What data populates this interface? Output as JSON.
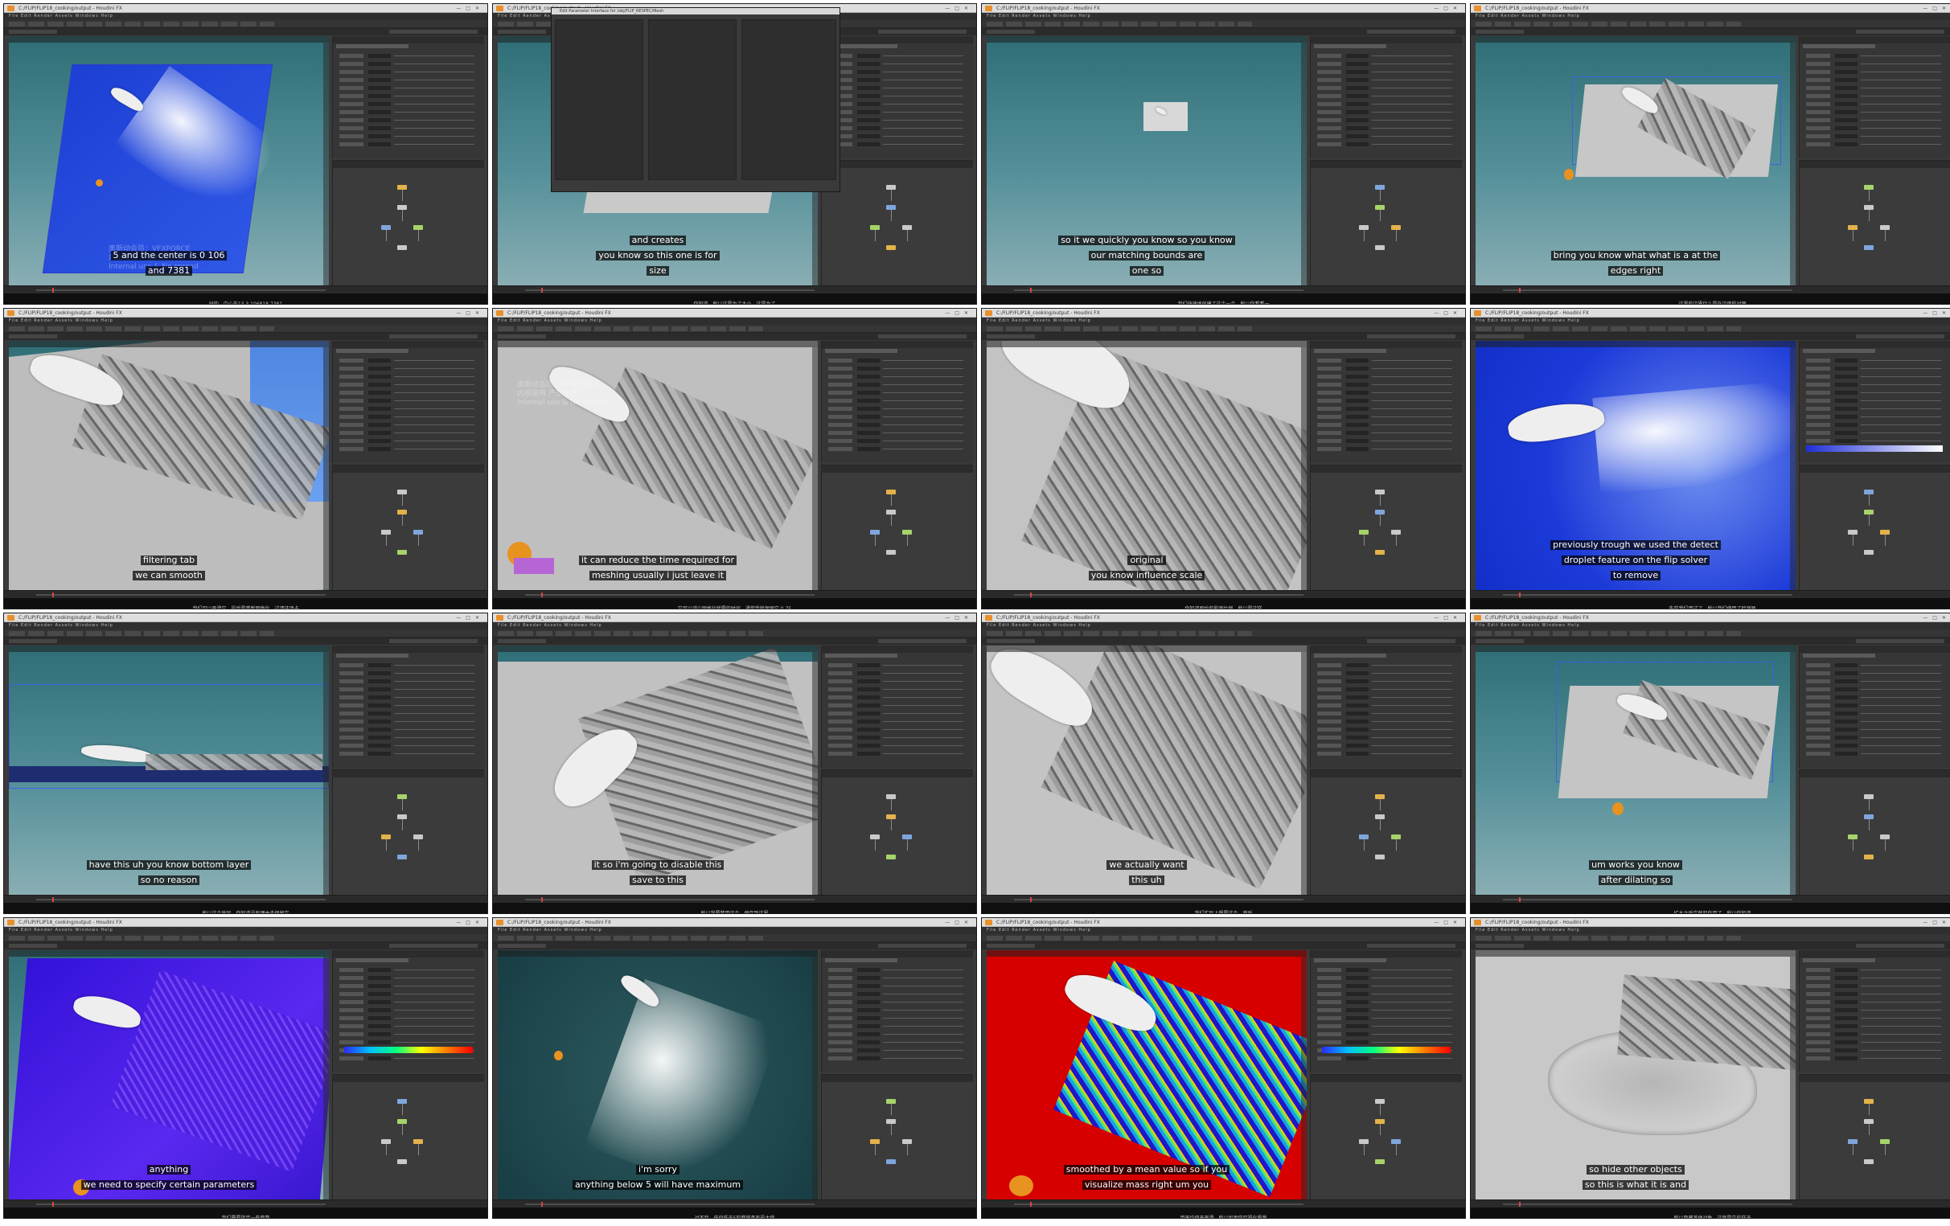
{
  "window": {
    "title": "C:/FLIP/FLIP18_cooking/output - Houdini FX",
    "menu": "File  Edit  Render  Assets  Windows  Help",
    "dialog_title": "Edit Parameter Interface for /obj/FLIP_RESPEC/Mesh"
  },
  "watermark": {
    "line1": "奥斯动会员：VFXFORCE",
    "line2": "内部使用 严禁外传",
    "line3": "Internal use & No spread"
  },
  "colors": {
    "app_bg": "#3a3a3a",
    "accent": "#e3b24a",
    "subtitle_bg": "#000000"
  },
  "frames": [
    {
      "subtitles": [
        "5 and the center is 0 106",
        "and 7381"
      ],
      "zh": "好的，中心在13.3 106818 7381"
    },
    {
      "subtitles": [
        "and creates",
        "you know so this one is for",
        "size"
      ],
      "zh": "你知道，所以这是为了大小，这是为了"
    },
    {
      "subtitles": [
        "so it we quickly you know so you know",
        "our matching bounds are",
        "one so"
      ],
      "zh": "我们快速地创建了这个一个，所以你看看一"
    },
    {
      "subtitles": [
        "bring you know what what is a at the",
        "edges right"
      ],
      "zh": "这里的边界什么是在边缘的对吧"
    },
    {
      "subtitles": [
        "filtering tab",
        "we can smooth"
      ],
      "zh": "我们可以平滑它，最后是重新网格化，过滤选项卡"
    },
    {
      "subtitles": [
        "it can reduce the time required for",
        "meshing usually i just leave it"
      ],
      "zh": "它可以减少网格化所需的时间，通常我就保留它 0.75"
    },
    {
      "subtitles": [
        "original",
        "you know influence scale"
      ],
      "zh": "你知道原始的影响比例，所以是这样"
    },
    {
      "subtitles": [
        "previously trough we used the detect",
        "droplet feature on the flip solver",
        "to remove"
      ],
      "zh": "先前我们用过了，所以我们使用了检测器"
    },
    {
      "subtitles": [
        "have this uh you know bottom layer",
        "so no reason"
      ],
      "zh": "所以这个底层，你知道没有理由去保留它"
    },
    {
      "subtitles": [
        "it so i'm going to disable this",
        "save to this"
      ],
      "zh": "所以我要禁用这个，保存到这里"
    },
    {
      "subtitles": [
        "we actually want",
        "this uh"
      ],
      "zh": "我们实际上想要这个，然后"
    },
    {
      "subtitles": [
        "um works you know",
        "after dilating so"
      ],
      "zh": "扩大之后它就起作用了，所以你知道"
    },
    {
      "subtitles": [
        "anything",
        "we need to specify certain parameters"
      ],
      "zh": "我们需要指定一些参数"
    },
    {
      "subtitles": [
        "i'm sorry",
        "anything below 5 will have maximum"
      ],
      "zh": "对不起，任何低于5的都将具有最大值"
    },
    {
      "subtitles": [
        "smoothed by a mean value so if you",
        "visualize mass right um you"
      ],
      "zh": "用平均值来平滑，所以如果你可视化质量"
    },
    {
      "subtitles": [
        "so hide other objects",
        "so this is what it is and"
      ],
      "zh": "所以隐藏其他对象，这就是它的样子"
    }
  ]
}
